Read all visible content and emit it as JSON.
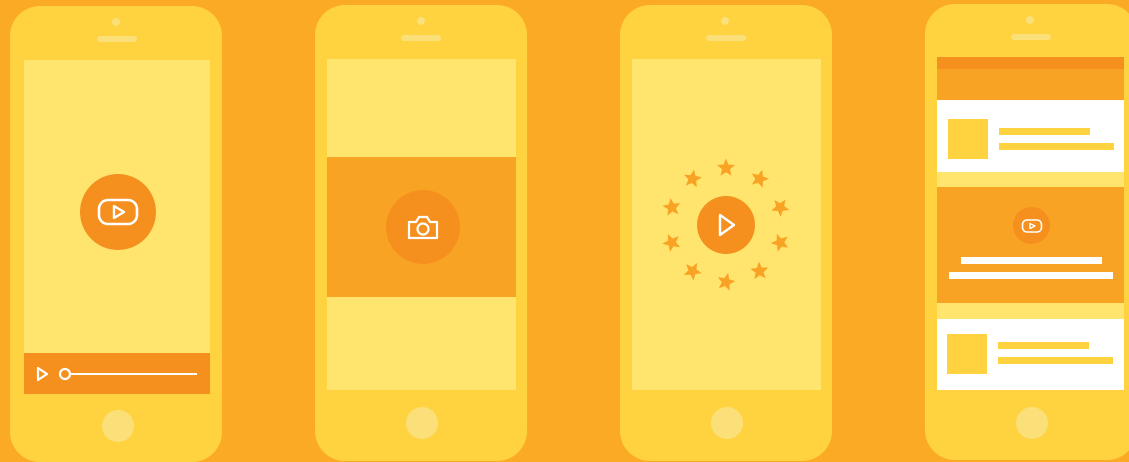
{
  "colors": {
    "background": "#FBAA26",
    "phone_body": "#FFD23F",
    "screen": "#FFE56E",
    "accent": "#F58F1E",
    "band": "#F9A324",
    "card": "#FFFFFF"
  },
  "phones": [
    {
      "id": "video-player",
      "icon": "youtube-play-icon",
      "controls": [
        "play-icon",
        "progress-slider"
      ]
    },
    {
      "id": "camera",
      "icon": "camera-icon"
    },
    {
      "id": "rated-video",
      "icon": "play-icon",
      "star_count": 10
    },
    {
      "id": "feed",
      "icon": "youtube-play-icon",
      "cards": 2
    }
  ]
}
